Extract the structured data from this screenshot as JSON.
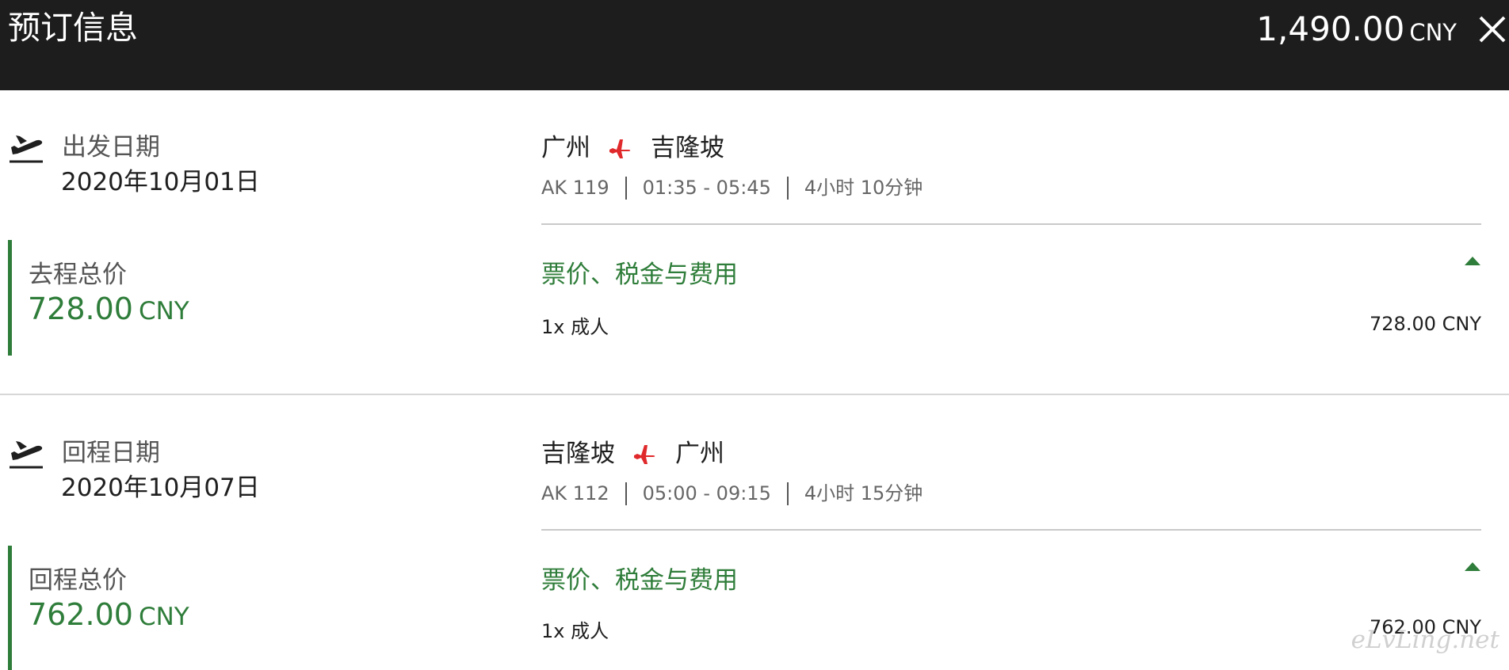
{
  "header": {
    "title": "预订信息",
    "total_amount": "1,490.00",
    "total_currency": "CNY"
  },
  "legs": [
    {
      "icon": "airplane-departure-icon",
      "date_label": "出发日期",
      "date": "2020年10月01日",
      "price_label": "去程总价",
      "price_amount": "728.00",
      "price_currency": "CNY",
      "origin": "广州",
      "destination": "吉隆坡",
      "flight_no": "AK 119",
      "time": "01:35 - 05:45",
      "duration": "4小时 10分钟",
      "fees_title": "票价、税金与费用",
      "pax": "1x 成人",
      "pax_amount": "728.00 CNY"
    },
    {
      "icon": "airplane-departure-icon",
      "date_label": "回程日期",
      "date": "2020年10月07日",
      "price_label": "回程总价",
      "price_amount": "762.00",
      "price_currency": "CNY",
      "origin": "吉隆坡",
      "destination": "广州",
      "flight_no": "AK 112",
      "time": "05:00 - 09:15",
      "duration": "4小时 15分钟",
      "fees_title": "票价、税金与费用",
      "pax": "1x 成人",
      "pax_amount": "762.00 CNY"
    }
  ],
  "watermark": "eLvLing.net",
  "colors": {
    "header_bg": "#1d1d1d",
    "accent_green": "#2f7d3a",
    "plane_red": "#e0292b"
  }
}
